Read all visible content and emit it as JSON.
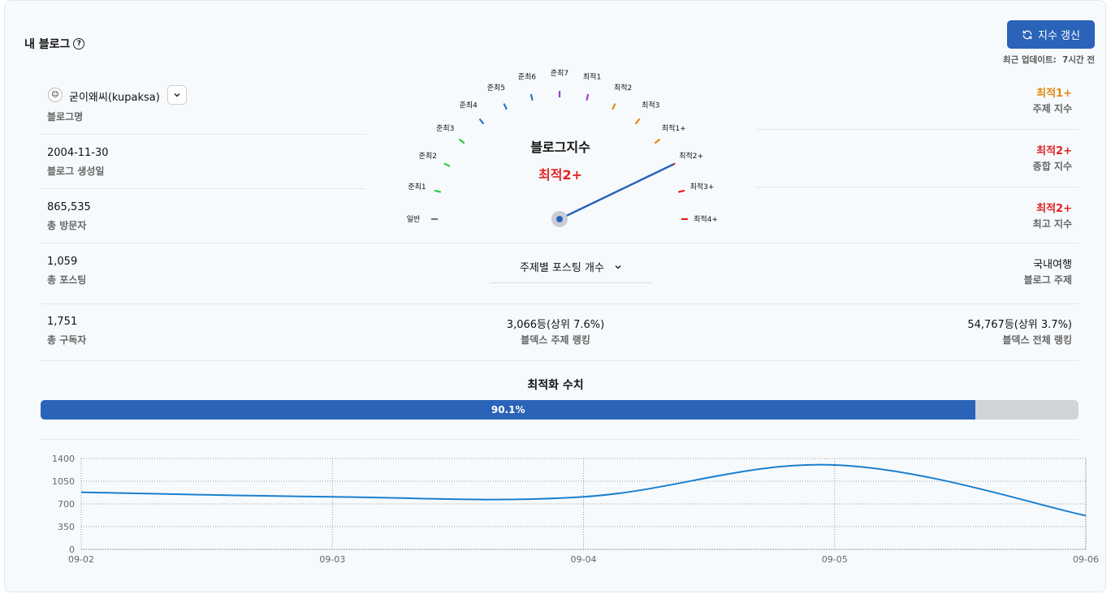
{
  "header": {
    "title": "내 블로그",
    "help_icon": "help-circle-icon",
    "refresh_label": "지수 갱신",
    "refresh_icon": "refresh-icon",
    "updated_label": "최근 업데이트:",
    "updated_value": "7시간 전"
  },
  "left": {
    "blog_name": {
      "value": "굳이왜씨(kupaksa)",
      "label": "블로그명"
    },
    "created": {
      "value": "2004-11-30",
      "label": "블로그 생성일"
    },
    "visitors": {
      "value": "865,535",
      "label": "총 방문자"
    },
    "posts": {
      "value": "1,059",
      "label": "총 포스팅"
    },
    "subscribers": {
      "value": "1,751",
      "label": "총 구독자"
    }
  },
  "right": {
    "topic_index": {
      "value": "최적1+",
      "label": "주제 지수",
      "color": "#e08a12"
    },
    "overall_index": {
      "value": "최적2+",
      "label": "종합 지수",
      "color": "#e02424"
    },
    "max_index": {
      "value": "최적2+",
      "label": "최고 지수",
      "color": "#e02424"
    },
    "blog_topic": {
      "value": "국내여행",
      "label": "블로그 주제"
    },
    "total_rank": {
      "value": "54,767등(상위 3.7%)",
      "label": "블덱스 전체 랭킹"
    }
  },
  "center": {
    "topic_rank": {
      "value": "3,066등(상위 7.6%)",
      "label": "블덱스 주제 랭킹"
    },
    "topic_select_label": "주제별 포스팅 개수"
  },
  "gauge": {
    "title": "블로그지수",
    "value": "최적2+",
    "levels": [
      {
        "label": "일반",
        "color": "#777777"
      },
      {
        "label": "준최1",
        "color": "#2ecc40"
      },
      {
        "label": "준최2",
        "color": "#2ecc40"
      },
      {
        "label": "준최3",
        "color": "#2ecc40"
      },
      {
        "label": "준최4",
        "color": "#2a78c8"
      },
      {
        "label": "준최5",
        "color": "#2a78c8"
      },
      {
        "label": "준최6",
        "color": "#2a78c8"
      },
      {
        "label": "준최7",
        "color": "#a23bd6"
      },
      {
        "label": "최적1",
        "color": "#a23bd6"
      },
      {
        "label": "최적2",
        "color": "#e08a12"
      },
      {
        "label": "최적3",
        "color": "#e08a12"
      },
      {
        "label": "최적1+",
        "color": "#e08a12"
      },
      {
        "label": "최적2+",
        "color": "#e02424"
      },
      {
        "label": "최적3+",
        "color": "#e02424"
      },
      {
        "label": "최적4+",
        "color": "#e02424"
      }
    ],
    "needle_index": 12
  },
  "progress": {
    "title": "최적화 수치",
    "value": 90.1,
    "label": "90.1%"
  },
  "chart_data": {
    "type": "line",
    "x": [
      "09-02",
      "09-03",
      "09-04",
      "09-05",
      "09-06"
    ],
    "series": [
      {
        "values": [
          880,
          810,
          810,
          1300,
          520
        ],
        "color": "#1a80d0"
      }
    ],
    "ylim": [
      0,
      1400
    ],
    "yticks": [
      0,
      350,
      700,
      1050,
      1400
    ],
    "grid": true
  }
}
